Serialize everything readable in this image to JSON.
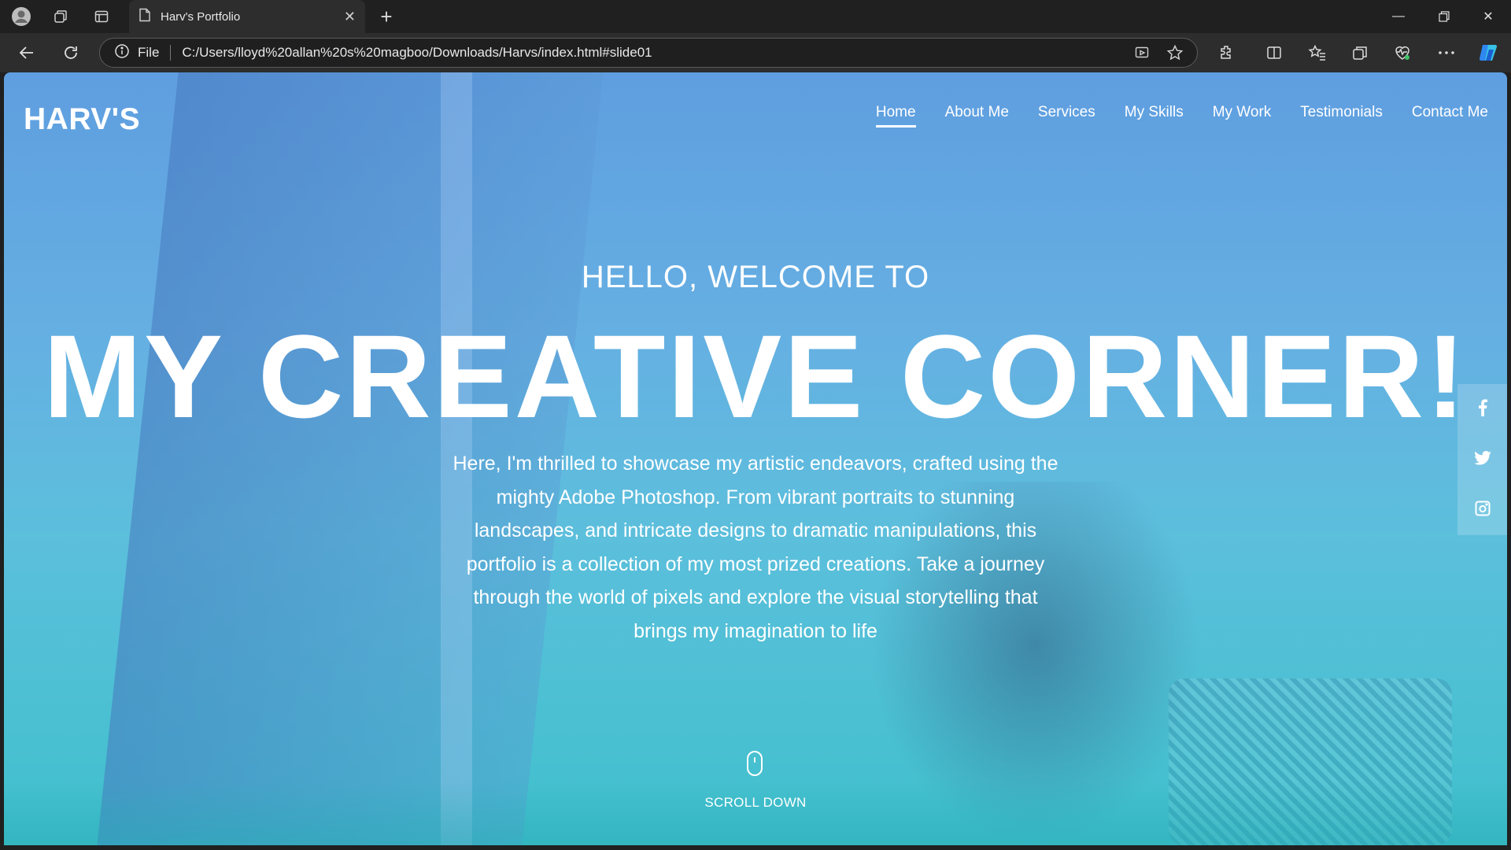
{
  "browser": {
    "tab_title": "Harv's Portfolio",
    "address_label": "File",
    "url": "C:/Users/lloyd%20allan%20s%20magboo/Downloads/Harvs/index.html#slide01"
  },
  "site": {
    "logo": "HARV'S",
    "nav": [
      {
        "label": "Home",
        "active": true
      },
      {
        "label": "About Me"
      },
      {
        "label": "Services"
      },
      {
        "label": "My Skills"
      },
      {
        "label": "My Work"
      },
      {
        "label": "Testimonials"
      },
      {
        "label": "Contact Me"
      }
    ],
    "hero": {
      "welcome": "HELLO, WELCOME TO",
      "headline": "MY CREATIVE CORNER!",
      "intro": "Here, I'm thrilled to showcase my artistic endeavors, crafted using the mighty Adobe Photoshop. From vibrant portraits to stunning landscapes, and intricate designs to dramatic manipulations, this portfolio is a collection of my most prized creations. Take a journey through the world of pixels and explore the visual storytelling that brings my imagination to life"
    },
    "scroll_label": "SCROLL DOWN",
    "social": [
      "facebook-icon",
      "twitter-icon",
      "instagram-icon"
    ]
  }
}
